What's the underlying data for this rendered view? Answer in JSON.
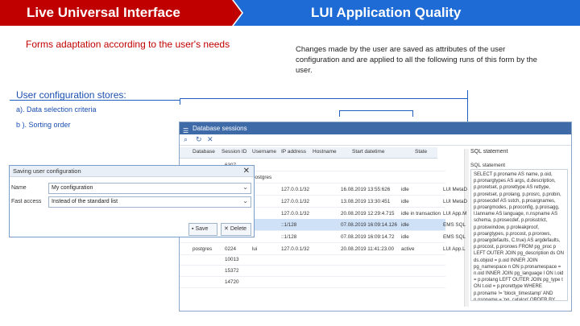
{
  "header": {
    "left_title": "Live Universal Interface",
    "right_title": "LUI Application Quality"
  },
  "lead": "Forms adaptation according to the user's needs",
  "description": "Changes made by the user are saved as attributes of the user configuration and are applied to all the following runs of this form by the user.",
  "stores": {
    "title": "User configuration stores:",
    "items": [
      "a). Data selection criteria",
      "b ). Sorting order"
    ]
  },
  "window": {
    "title": "Database sessions",
    "columns": [
      "Database",
      "Session ID",
      "Username",
      "IP address",
      "Hostname",
      "Start datetime",
      "State"
    ],
    "sql_header": "SQL statement",
    "sql_label": "SQL statement",
    "rows": [
      {
        "db": "",
        "sid": "6307",
        "user": "",
        "ip": "",
        "host": "",
        "start": "",
        "state": "",
        "app": ""
      },
      {
        "db": "",
        "sid": "",
        "user": "postgres",
        "ip": "",
        "host": "",
        "start": "",
        "state": "",
        "app": ""
      },
      {
        "db": "",
        "sid": "",
        "user": "",
        "ip": "127.0.0.1/32",
        "host": "",
        "start": "16.08.2019 13:55:626",
        "state": "idle",
        "app": "LUI MetaD"
      },
      {
        "db": "",
        "sid": "",
        "user": "",
        "ip": "127.0.0.1/32",
        "host": "",
        "start": "13.08.2019 13:30:451",
        "state": "idle",
        "app": "LUI MetaD"
      },
      {
        "db": "",
        "sid": "",
        "user": "",
        "ip": "127.0.0.1/32",
        "host": "",
        "start": "20.08.2019 12:29:4.715",
        "state": "idle in transaction",
        "app": "LUI App.M"
      },
      {
        "db": "",
        "sid": "",
        "user": "",
        "ip": "::1/128",
        "host": "",
        "start": "07.08.2019 16:09:14.126",
        "state": "idle",
        "app": "EMS SQL"
      },
      {
        "db": "",
        "sid": "",
        "user": "",
        "ip": "::1/128",
        "host": "",
        "start": "07.08.2019 16:09:14.72",
        "state": "idle",
        "app": "EMS SQL"
      },
      {
        "db": "postgres",
        "sid": "0224",
        "user": "lui",
        "ip": "127.0.0.1/32",
        "host": "",
        "start": "20.08.2019 11:41:23.00",
        "state": "active",
        "app": "LUI App.L"
      },
      {
        "db": "",
        "sid": "10013",
        "user": "",
        "ip": "",
        "host": "",
        "start": "",
        "state": "",
        "app": ""
      },
      {
        "db": "",
        "sid": "15372",
        "user": "",
        "ip": "",
        "host": "",
        "start": "",
        "state": "",
        "app": ""
      },
      {
        "db": "",
        "sid": "14720",
        "user": "",
        "ip": "",
        "host": "",
        "start": "",
        "state": "",
        "app": ""
      }
    ],
    "sql_text": "SELECT p.proname AS name, p.oid, p.pronargtypes AS args, d.description, p.proretset, p.prorettype AS rettype, p.proretset, p.prolang, p.prosrc, p.probin, p.prosecdef AS sstch, p.proargnames, p.proargmodes, p.proconfig, p.proisagg, l.lanname AS language, n.nspname AS schema, p.prosecdef, p.proisstrict, p.proiswindow, p.proleakproof, p.proargtypes, p.procost, p.prorows, p.proargdefaults, C.true) AS argdefaults, p.procost, p.prorows FROM pg_proc p LEFT OUTER JOIN pg_description ds ON ds.objoid = p.oid INNER JOIN pg_namespace n ON p.pronamespace = n.oid INNER JOIN pg_language l ON l.oid = p.prolang LEFT OUTER JOIN pg_type t ON t.oid = p.prorettype WHERE p.proname != 'block_timestamp' AND n.nspname = 'pg_catalog' ORDER BY n.nspname, p.proname"
  },
  "dialog": {
    "title": "Saving user configuration",
    "name_label": "Name",
    "name_value": "My configuration",
    "access_label": "Fast access",
    "access_value": "Instead of the standard list",
    "save_label": "Save",
    "delete_label": "Delete"
  }
}
